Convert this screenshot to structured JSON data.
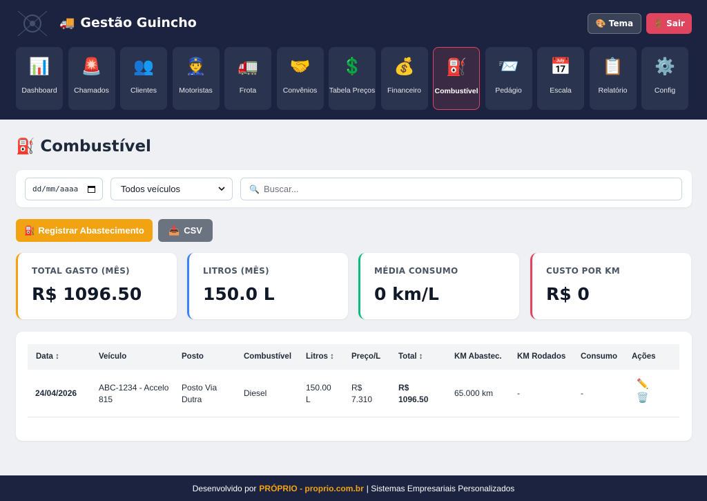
{
  "header": {
    "brand_icon": "🚚",
    "brand": "Gestão Guincho",
    "tema_icon": "🎨",
    "tema_label": "Tema",
    "sair_icon": "🚪",
    "sair_label": "Sair"
  },
  "nav": [
    {
      "icon": "📊",
      "label": "Dashboard"
    },
    {
      "icon": "🚨",
      "label": "Chamados"
    },
    {
      "icon": "👥",
      "label": "Clientes"
    },
    {
      "icon": "👮",
      "label": "Motoristas"
    },
    {
      "icon": "🚛",
      "label": "Frota"
    },
    {
      "icon": "🤝",
      "label": "Convênios"
    },
    {
      "icon": "💲",
      "label": "Tabela Preços"
    },
    {
      "icon": "💰",
      "label": "Financeiro"
    },
    {
      "icon": "⛽",
      "label": "Combustível",
      "active": true
    },
    {
      "icon": "📨",
      "label": "Pedágio"
    },
    {
      "icon": "📅",
      "label": "Escala"
    },
    {
      "icon": "📋",
      "label": "Relatório"
    },
    {
      "icon": "⚙️",
      "label": "Config"
    }
  ],
  "page": {
    "title_icon": "⛽",
    "title": "Combustível"
  },
  "filters": {
    "date_placeholder": "dd/mm/aaaa",
    "vehicle_selected": "Todos veículos",
    "search_icon": "🔍",
    "search_placeholder": "Buscar..."
  },
  "actions": {
    "register_icon": "⛽",
    "register_label": "Registrar Abastecimento",
    "csv_icon": "📥",
    "csv_label": "CSV"
  },
  "stats": [
    {
      "label": "TOTAL GASTO (MÊS)",
      "value": "R$ 1096.50",
      "color": "#f2a311"
    },
    {
      "label": "LITROS (MÊS)",
      "value": "150.0 L",
      "color": "#3b82f6"
    },
    {
      "label": "MÉDIA CONSUMO",
      "value": "0 km/L",
      "color": "#10b981"
    },
    {
      "label": "CUSTO POR KM",
      "value": "R$ 0",
      "color": "#e0445f"
    }
  ],
  "table": {
    "columns": [
      "Data ↕",
      "Veículo",
      "Posto",
      "Combustível",
      "Litros ↕",
      "Preço/L",
      "Total ↕",
      "KM Abastec.",
      "KM Rodados",
      "Consumo",
      "Ações"
    ],
    "rows": [
      {
        "data": "24/04/2026",
        "veiculo": "ABC-1234 - Accelo 815",
        "posto": "Posto Via Dutra",
        "combustivel": "Diesel",
        "litros": "150.00 L",
        "preco": "R$ 7.310",
        "total": "R$ 1096.50",
        "km_abastec": "65.000 km",
        "km_rodados": "-",
        "consumo": "-",
        "edit_icon": "✏️",
        "delete_icon": "🗑️"
      }
    ]
  },
  "footer": {
    "prefix": "Desenvolvido por",
    "company": "PRÓPRIO - proprio.com.br",
    "suffix": "| Sistemas Empresariais Personalizados"
  }
}
